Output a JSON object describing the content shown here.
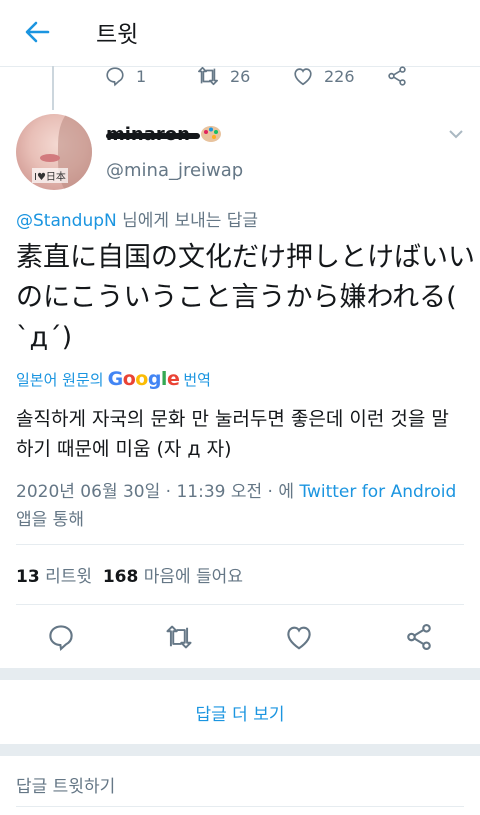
{
  "header": {
    "title": "트윗"
  },
  "previous_tweet": {
    "replies": "1",
    "retweets": "26",
    "likes": "226"
  },
  "tweet": {
    "display_name": "minaron",
    "handle": "@mina_jreiwap",
    "avatar_tag": "I♥日本",
    "reply_prefix_handle": "@StandupN",
    "reply_suffix": " 님에게 보내는 답글",
    "text": "素直に自国の文化だけ押しとけばいいのにこういうこと言うから嫌われる( ˋдˊ)",
    "translate_label": "일본어 원문의",
    "translate_provider": "Google",
    "translate_action": "번역",
    "translated_text": "솔직하게 자국의 문화 만 눌러두면 좋은데 이런 것을 말하기 때문에 미움 (자 д 자)",
    "timestamp": "2020년 06월 30일 · 11:39 오전 · 에 ",
    "client": "Twitter for Android",
    "client_suffix": " 앱을 통해",
    "retweet_count": "13",
    "retweet_label": " 리트윗  ",
    "like_count": "168",
    "like_label": " 마음에 들어요"
  },
  "footer": {
    "more_replies": "답글 더 보기",
    "reply_placeholder": "답글 트윗하기"
  },
  "colors": {
    "accent": "#1b95e0",
    "secondary_text": "#657786",
    "divider": "#e6ecf0"
  }
}
